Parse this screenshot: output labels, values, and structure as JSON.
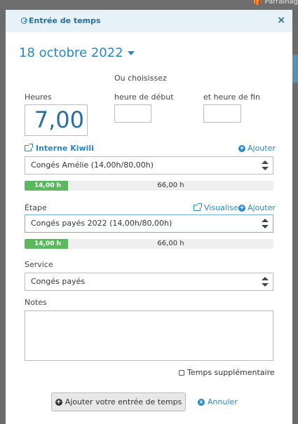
{
  "background": {
    "top_right_link": "Parrainag"
  },
  "modal": {
    "title": "Entrée de temps",
    "close_symbol": "×",
    "date": "18 octobre 2022",
    "hours": {
      "label": "Heures",
      "value": "7,00"
    },
    "or_choose_label": "Ou choisissez",
    "start_time": {
      "label": "heure de début",
      "value": ""
    },
    "end_time": {
      "label": "et heure de fin",
      "value": ""
    },
    "project": {
      "link_label": "Interne Kiwili",
      "add_label": "Ajouter",
      "selected": "Congés Amélie (14,00h/80,00h)",
      "progress_used": "14,00 h",
      "progress_remaining": "66,00 h",
      "progress_fraction": 0.175
    },
    "step": {
      "label": "Étape",
      "view_label": "Visualiser",
      "add_label": "Ajouter",
      "selected": "Congés payés 2022 (14,00h/80,00h)",
      "progress_used": "14,00 h",
      "progress_remaining": "66,00 h",
      "progress_fraction": 0.175
    },
    "service": {
      "label": "Service",
      "selected": "Congés payés"
    },
    "notes": {
      "label": "Notes",
      "value": ""
    },
    "overtime_label": "Temps supplémentaire",
    "submit_label": "Ajouter votre entrée de temps",
    "cancel_label": "Annuler"
  },
  "colors": {
    "accent": "#2a86c4",
    "header_bg": "#e6f1f8",
    "progress": "#5cb85c"
  }
}
